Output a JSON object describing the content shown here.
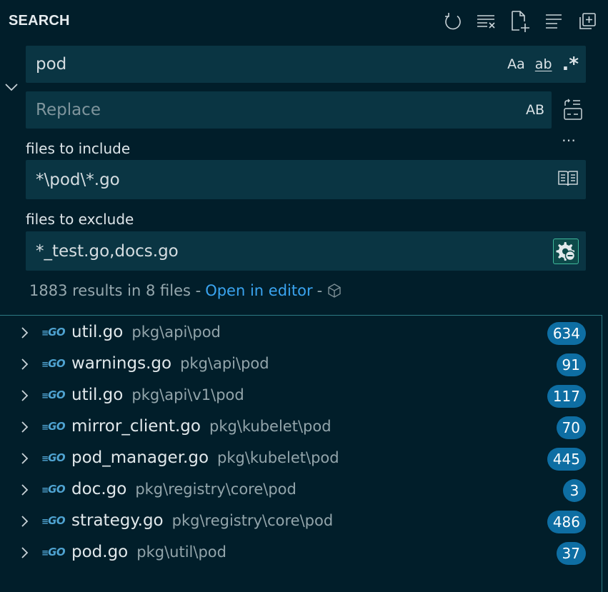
{
  "header": {
    "title": "SEARCH"
  },
  "search": {
    "value": "pod",
    "case_label": "Aa",
    "word_label": "ab",
    "regex_label": ".*"
  },
  "replace": {
    "placeholder": "Replace",
    "preserve_case_label": "AB"
  },
  "include": {
    "label": "files to include",
    "value": "*\\pod\\*.go"
  },
  "exclude": {
    "label": "files to exclude",
    "value": "*_test.go,docs.go"
  },
  "summary": {
    "text": "1883 results in 8 files -",
    "link": "Open in editor",
    "sep": "-"
  },
  "more_label": "…",
  "results": [
    {
      "file": "util.go",
      "path": "pkg\\api\\pod",
      "count": "634"
    },
    {
      "file": "warnings.go",
      "path": "pkg\\api\\pod",
      "count": "91"
    },
    {
      "file": "util.go",
      "path": "pkg\\api\\v1\\pod",
      "count": "117"
    },
    {
      "file": "mirror_client.go",
      "path": "pkg\\kubelet\\pod",
      "count": "70"
    },
    {
      "file": "pod_manager.go",
      "path": "pkg\\kubelet\\pod",
      "count": "445"
    },
    {
      "file": "doc.go",
      "path": "pkg\\registry\\core\\pod",
      "count": "3"
    },
    {
      "file": "strategy.go",
      "path": "pkg\\registry\\core\\pod",
      "count": "486"
    },
    {
      "file": "pod.go",
      "path": "pkg\\util\\pod",
      "count": "37"
    }
  ],
  "go_icon_label": "GO",
  "colors": {
    "background": "#011e2a",
    "field": "#0a3543",
    "badge": "#0e6ea3",
    "link": "#3aa4f0",
    "accent_border": "#3fb89b"
  }
}
